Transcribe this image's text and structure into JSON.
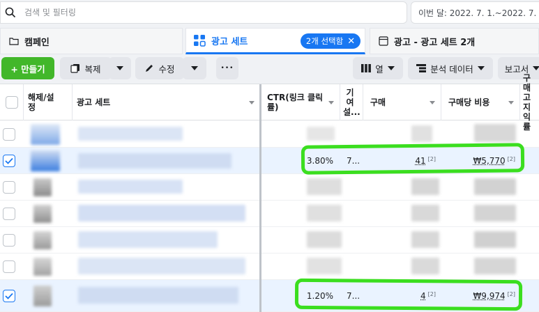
{
  "search": {
    "placeholder": "검색 및 필터링"
  },
  "date_range": "이번 달: 2022. 7. 1.~2022. 7. 10.",
  "tabs": {
    "campaign": "캠페인",
    "adset": "광고 세트",
    "selected_chip": "2개 선택함",
    "ads": "광고 - 광고 세트 2개"
  },
  "toolbar": {
    "create": "+ 만들기",
    "duplicate": "복제",
    "edit": "수정",
    "more": "•••",
    "columns": "열",
    "breakdown": "분석 데이터",
    "reports": "보고서"
  },
  "table": {
    "headers": {
      "toggle": "해제/설정",
      "adset": "광고 세트",
      "ctr": "CTR(링크 클릭률)",
      "contribution": "기여 설...",
      "purchases": "구매",
      "cost_per_purchase": "구매당 비용",
      "more": "구매 고 지 익률"
    },
    "rows": [
      {
        "selected": false
      },
      {
        "selected": true,
        "ctr": "3.80%",
        "attr": "7...",
        "purchases": "41",
        "purchases_ref": "[2]",
        "cost": "₩5,770",
        "cost_ref": "[2]"
      },
      {
        "selected": false
      },
      {
        "selected": false
      },
      {
        "selected": false
      },
      {
        "selected": false
      },
      {
        "selected": true,
        "ctr": "1.20%",
        "attr": "7...",
        "purchases": "4",
        "purchases_ref": "[2]",
        "cost": "₩9,974",
        "cost_ref": "[2]"
      }
    ]
  },
  "colors": {
    "accent": "#1877f2",
    "create": "#42b72a",
    "highlight": "#3bde1f"
  }
}
